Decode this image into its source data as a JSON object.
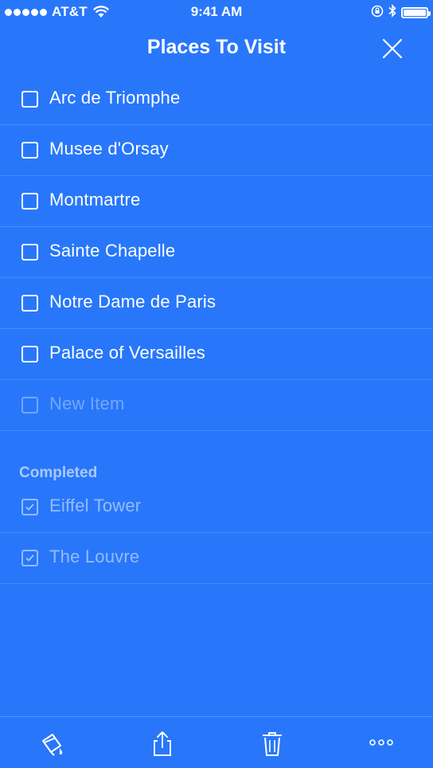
{
  "status_bar": {
    "carrier": "AT&T",
    "time": "9:41 AM"
  },
  "header": {
    "title": "Places To Visit",
    "close_icon": "close-icon"
  },
  "items": [
    {
      "label": "Arc de Triomphe",
      "checked": false
    },
    {
      "label": "Musee d'Orsay",
      "checked": false
    },
    {
      "label": "Montmartre",
      "checked": false
    },
    {
      "label": "Sainte Chapelle",
      "checked": false
    },
    {
      "label": "Notre Dame de Paris",
      "checked": false
    },
    {
      "label": "Palace of Versailles",
      "checked": false
    }
  ],
  "new_item": {
    "placeholder": "New Item"
  },
  "completed": {
    "heading": "Completed",
    "items": [
      {
        "label": "Eiffel Tower",
        "checked": true
      },
      {
        "label": "The Louvre",
        "checked": true
      }
    ]
  },
  "toolbar": {
    "icons": [
      "paint-bucket-icon",
      "share-icon",
      "trash-icon",
      "more-icon"
    ]
  },
  "colors": {
    "background": "#2877fb",
    "text": "#ffffff"
  }
}
